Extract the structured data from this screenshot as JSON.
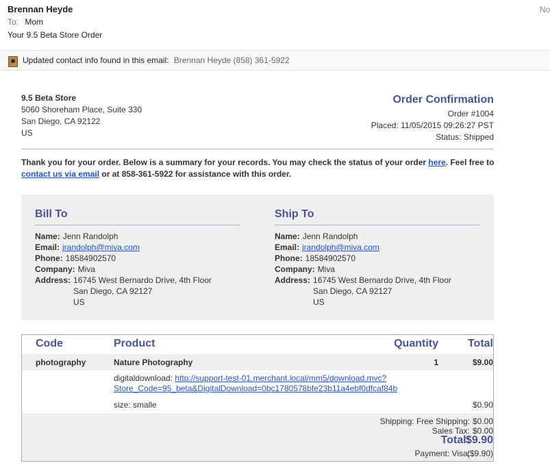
{
  "mail": {
    "sender": "Brennan Heyde",
    "date_truncated": "No",
    "to_label": "To:",
    "to_value": "Mom",
    "subject": "Your 9.5 Beta Store Order",
    "notice_text": "Updated contact info found in this email:",
    "notice_detail": "Brennan Heyde (858) 361-5922"
  },
  "store": {
    "name": "9.5 Beta Store",
    "line1": "5060 Shoreham Place, Suite 330",
    "line2": "San Diego, CA 92122",
    "country": "US"
  },
  "order": {
    "title": "Order Confirmation",
    "number": "Order #1004",
    "placed": "Placed: 11/05/2015 09:26:27 PST",
    "status": "Status: Shipped"
  },
  "thanks": {
    "part1": "Thank you for your order. Below is a summary for your records. You may check the status of your order",
    "link1": "here",
    "part2": ". Feel free to",
    "link2": "contact us via email",
    "part3": "or at 858-361-5922 for assistance with this order."
  },
  "bill": {
    "heading": "Bill To",
    "name_label": "Name:",
    "name": "Jenn Randolph",
    "email_label": "Email:",
    "email": "jrandolph@miva.com",
    "phone_label": "Phone:",
    "phone": "18584902570",
    "company_label": "Company:",
    "company": "Miva",
    "address_label": "Address:",
    "address1": "16745 West Bernardo Drive, 4th Floor",
    "address2": "San Diego, CA 92127",
    "address3": "US"
  },
  "ship": {
    "heading": "Ship To",
    "name_label": "Name:",
    "name": "Jenn Randolph",
    "email_label": "Email:",
    "email": "jrandolph@miva.com",
    "phone_label": "Phone:",
    "phone": "18584902570",
    "company_label": "Company:",
    "company": "Miva",
    "address_label": "Address:",
    "address1": "16745 West Bernardo Drive, 4th Floor",
    "address2": "San Diego, CA 92127",
    "address3": "US"
  },
  "items": {
    "headers": {
      "code": "Code",
      "product": "Product",
      "quantity": "Quantity",
      "total": "Total"
    },
    "rows": [
      {
        "code": "photography",
        "product": "Nature Photography",
        "quantity": "1",
        "total": "$9.00"
      }
    ],
    "download_label": "digitaldownload:",
    "download_link_line1": "http://support-test-01.merchant.local/mm5/download.mvc?",
    "download_link_line2": "Store_Code=95_beta&DigitalDownload=0bc1780578bfe23b11a4ebf0dfcaf84b",
    "option_label": "size: smalle",
    "option_price": "$0.90"
  },
  "totals": {
    "shipping_label": "Shipping: Free Shipping:",
    "shipping": "$0.00",
    "tax_label": "Sales Tax:",
    "tax": "$0.00",
    "total_label": "Total:",
    "total": "$9.90",
    "payment_label": "Payment: Visa:",
    "payment": "($9.90)"
  },
  "colors": {
    "accent": "#4a5399",
    "link": "#2255cc",
    "panel": "#efefef"
  },
  "icons": {
    "contact": "contact-card-icon"
  }
}
